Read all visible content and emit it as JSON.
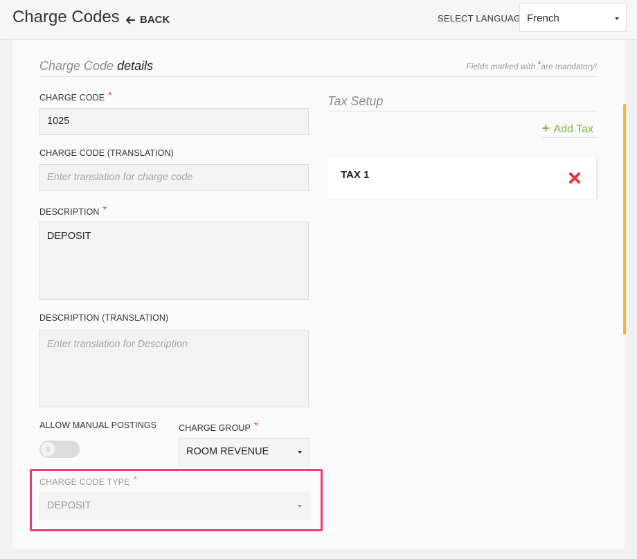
{
  "header": {
    "title": "Charge Codes",
    "back_label": "BACK",
    "language_label": "SELECT LANGUAGE",
    "language_value": "French"
  },
  "details": {
    "title_prefix": "Charge Code",
    "title_emphasis": "details",
    "mandatory_note_pre": "Fields marked with",
    "mandatory_star": "*",
    "mandatory_note_post": "are mandatory!"
  },
  "form": {
    "charge_code": {
      "label": "CHARGE CODE",
      "value": "1025"
    },
    "charge_code_translation": {
      "label": "CHARGE CODE (TRANSLATION)",
      "placeholder": "Enter translation for charge code"
    },
    "description": {
      "label": "DESCRIPTION",
      "value": "DEPOSIT"
    },
    "description_translation": {
      "label": "DESCRIPTION (TRANSLATION)",
      "placeholder": "Enter translation for Description"
    },
    "allow_manual_postings": {
      "label": "ALLOW MANUAL POSTINGS",
      "enabled": false
    },
    "charge_group": {
      "label": "CHARGE GROUP",
      "value": "ROOM REVENUE"
    },
    "charge_code_type": {
      "label": "CHARGE CODE TYPE",
      "value": "DEPOSIT"
    },
    "required_mark": "*"
  },
  "tax_setup": {
    "title": "Tax Setup",
    "add_label": "Add Tax",
    "add_icon": "+",
    "taxes": [
      {
        "name": "TAX 1"
      }
    ]
  },
  "colors": {
    "accent_green": "#7ab648",
    "required_red": "#e63946",
    "highlight_pink": "#f03a78",
    "scrollbar_yellow": "#f5b629"
  }
}
